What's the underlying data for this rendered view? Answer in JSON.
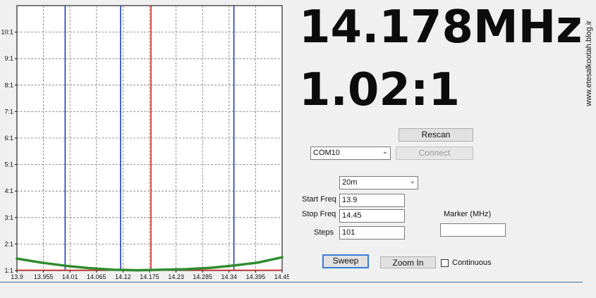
{
  "readout": {
    "frequency": "14.178MHz",
    "swr": "1.02:1"
  },
  "watermark": "www.etesalkootah.blog.ir",
  "buttons": {
    "rescan": "Rescan",
    "connect": "Connect",
    "sweep": "Sweep",
    "zoom_in": "Zoom In"
  },
  "port": {
    "selected": "COM10"
  },
  "band": {
    "selected": "20m"
  },
  "form": {
    "start_label": "Start Freq",
    "start_value": "13.9",
    "stop_label": "Stop Freq",
    "stop_value": "14.45",
    "steps_label": "Steps",
    "steps_value": "101",
    "marker_label": "Marker (MHz)",
    "marker_value": ""
  },
  "continuous": {
    "label": "Continuous",
    "checked": false
  },
  "chart_data": {
    "type": "line",
    "xlim": [
      13.9,
      14.45
    ],
    "ylim": [
      1,
      11
    ],
    "x_ticks": [
      "13.9",
      "13.955",
      "14.01",
      "14.065",
      "14.12",
      "14.175",
      "14.23",
      "14.285",
      "14.34",
      "14.395",
      "14.45"
    ],
    "y_ticks": [
      "1:1",
      "2:1",
      "3:1",
      "4:1",
      "5:1",
      "6:1",
      "7:1",
      "8:1",
      "9:1",
      "10:1"
    ],
    "grid": true,
    "swr_series": {
      "x": [
        13.9,
        13.95,
        14.0,
        14.05,
        14.1,
        14.15,
        14.178,
        14.2,
        14.25,
        14.3,
        14.35,
        14.4,
        14.45
      ],
      "y": [
        1.45,
        1.3,
        1.18,
        1.09,
        1.03,
        1.01,
        1.02,
        1.03,
        1.05,
        1.1,
        1.19,
        1.3,
        1.5
      ]
    },
    "band_markers": [
      14.0,
      14.115,
      14.35
    ],
    "marker_freq": 14.178,
    "colors": {
      "series": "#2e8b2e",
      "band": "#1f3fb0",
      "marker": "#d42020"
    }
  }
}
